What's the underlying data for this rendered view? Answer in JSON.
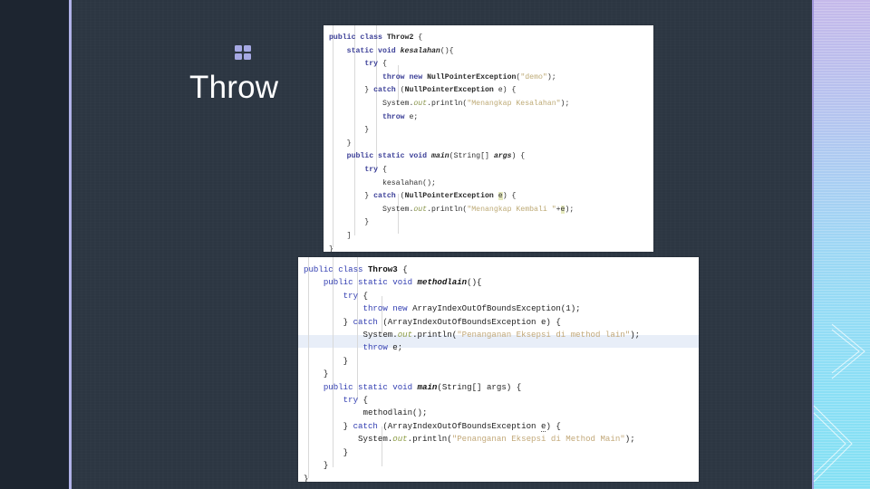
{
  "slide": {
    "title": "Throw",
    "bullet_icon": "grid-2x2-icon",
    "background_color": "#2c3642",
    "accent_color": "#b0b2e8"
  },
  "code_blocks": [
    {
      "id": "throw2",
      "language": "java",
      "class_name": "Throw2",
      "lines": [
        "public class Throw2 {",
        "    static void kesalahan(){",
        "        try {",
        "            throw new NullPointerException(\"demo\");",
        "        } catch (NullPointerException e) {",
        "            System.out.println(\"Menangkap Kesalahan\");",
        "            throw e;",
        "        }",
        "    }",
        "    public static void main(String[] args) {",
        "        try {",
        "            kesalahan();",
        "        } catch (NullPointerException e) {",
        "            System.out.println(\"Menangkap Kembali \"+e);",
        "        }",
        "    }",
        "}"
      ]
    },
    {
      "id": "throw3",
      "language": "java",
      "class_name": "Throw3",
      "lines": [
        "public class Throw3 {",
        "    public static void methodlain(){",
        "        try {",
        "            throw new ArrayIndexOutOfBoundsException(1);",
        "        } catch (ArrayIndexOutOfBoundsException e) {",
        "            System.out.println(\"Penanganan Eksepsi di method lain\");",
        "            throw e;",
        "        }",
        "    }",
        "    public static void main(String[] args) {",
        "        try {",
        "            methodlain();",
        "        } catch (ArrayIndexOutOfBoundsException e) {",
        "            System.out.println(\"Penanganan Eksepsi di Method Main\");",
        "        }",
        "    }",
        "}"
      ]
    }
  ],
  "strings": {
    "throw2_demo": "demo",
    "throw2_catch": "Menangkap Kesalahan",
    "throw2_recatch": "Menangkap Kembali ",
    "throw3_method": "Penanganan Eksepsi di method lain",
    "throw3_main": "Penanganan Eksepsi di Method Main"
  },
  "tokens": {
    "public": "public",
    "class": "class",
    "static": "static",
    "void": "void",
    "try": "try",
    "catch": "catch",
    "throw": "throw",
    "new": "new",
    "system": "System.",
    "out": "out",
    "println": ".println(",
    "string_args": "(String[] args) {",
    "npe": "NullPointerException",
    "aioobe": "ArrayIndexOutOfBoundsException",
    "main": "main",
    "kesalahan": "kesalahan",
    "methodlain": "methodlain",
    "var_e": "e",
    "one": "1"
  }
}
